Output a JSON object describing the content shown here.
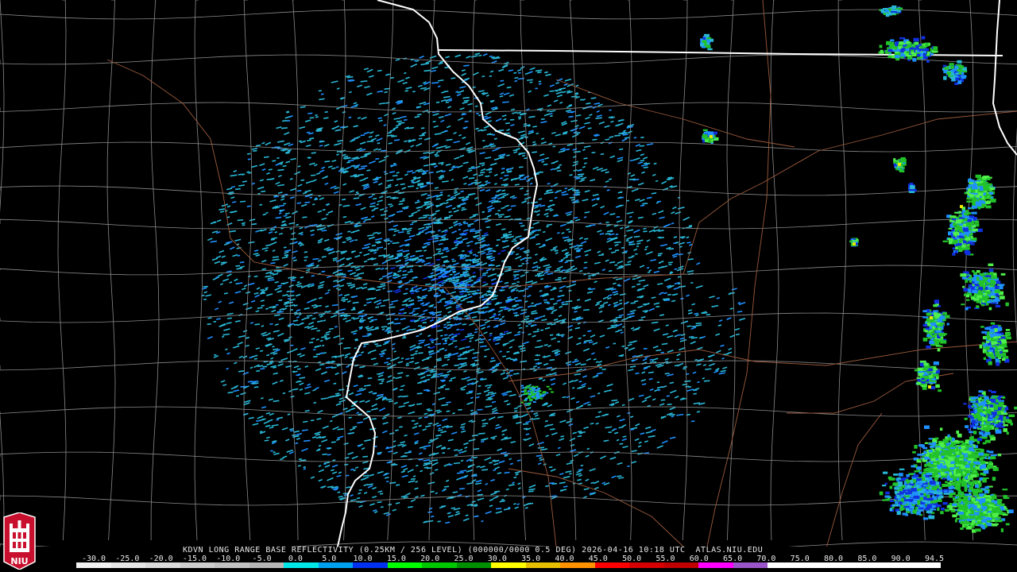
{
  "caption": "KDVN LONG RANGE BASE REFLECTIVITY (0.25KM / 256 LEVEL) (000000/0000 0.5 DEG) 2026-04-16 10:18 UTC  ATLAS.NIU.EDU",
  "scale": {
    "labels": [
      "-30.0",
      "-25.0",
      "-20.0",
      "-15.0",
      "-10.0",
      "-5.0",
      "0.0",
      "5.0",
      "10.0",
      "15.0",
      "20.0",
      "25.0",
      "30.0",
      "35.0",
      "40.0",
      "45.0",
      "50.0",
      "55.0",
      "60.0",
      "65.0",
      "70.0",
      "75.0",
      "80.0",
      "85.0",
      "90.0",
      "94.5"
    ],
    "colors": [
      "#f2f2f2",
      "#e6e6e6",
      "#dadada",
      "#cecece",
      "#c2c2c2",
      "#b6b6b6",
      "#00e6e6",
      "#00a0f0",
      "#0030f0",
      "#00ff00",
      "#00c800",
      "#009000",
      "#ffff00",
      "#e6c000",
      "#ff9000",
      "#ff0000",
      "#d60000",
      "#c00000",
      "#ff00ff",
      "#9955c9",
      "#ffffff",
      "#ffffff",
      "#ffffff",
      "#ffffff",
      "#ffffff"
    ]
  },
  "logo": {
    "text": "NIU",
    "color": "#c8102e"
  },
  "map": {
    "radar_site": "KDVN",
    "echo_colors": {
      "light": "#29b7d6",
      "mid": "#1e90ff",
      "deep": "#1030e0",
      "green": "#22c22a",
      "bright_green": "#4ff04a",
      "yellow": "#e8e800"
    },
    "line_colors": {
      "state_border": "#ffffff",
      "county_border": "#8a8a8a",
      "highway": "#9a5a3c"
    }
  }
}
